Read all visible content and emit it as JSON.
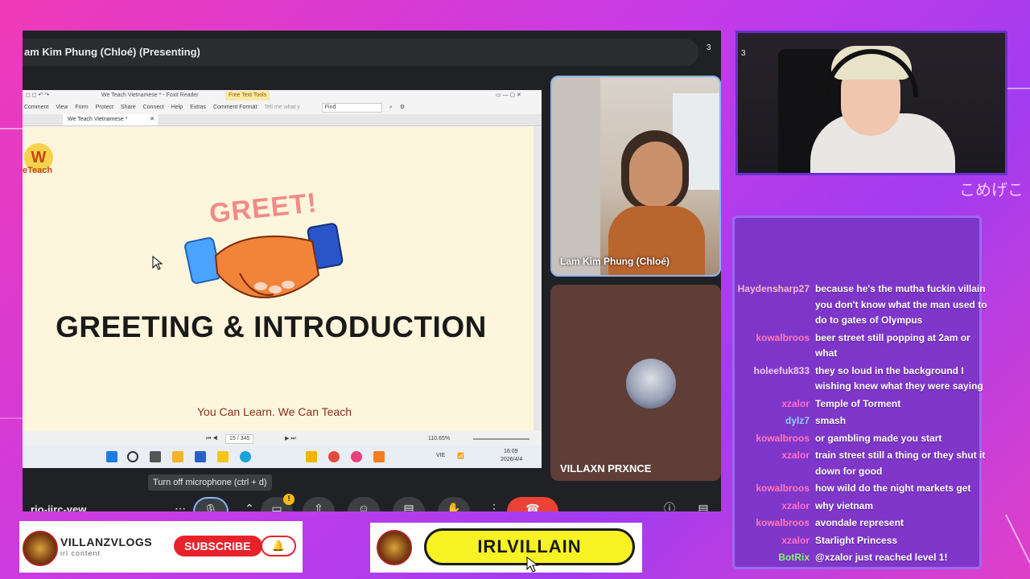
{
  "meet": {
    "presenting_label": "am Kim Phung (Chloé) (Presenting)",
    "participant_count": "3",
    "presenter_name": "Lam Kim Phung (Chloé)",
    "guest_name": "VILLAXN PRXNCE",
    "mic_tooltip": "Turn off microphone (ctrl + d)",
    "meeting_code": "rio-iirc-yew"
  },
  "foxit": {
    "window_title": "We Teach Vietnamese * - Foxit Reader",
    "free_text_tools": "Free Text Tools",
    "menu": [
      "Comment",
      "View",
      "Form",
      "Protect",
      "Share",
      "Connect",
      "Help",
      "Extras",
      "Comment Format",
      "Tell me what y"
    ],
    "find_placeholder": "Find",
    "doc_tab": "We Teach Vietnamese *",
    "page_indicator": "15 / 345",
    "zoom": "110.65%"
  },
  "slide": {
    "logo_letter": "W",
    "logo_text": "eTeach",
    "greet_word": "GREET!",
    "title": "GREETING & INTRODUCTION",
    "tagline": "You Can Learn. We Can Teach"
  },
  "taskbar": {
    "language": "VIE",
    "time": "16:09",
    "date": "2026/4/4"
  },
  "chat": {
    "messages": [
      {
        "user": "Haydensharp27",
        "color": "#f6b8c8",
        "text": "because he's the mutha fuckin villain you don't know what the man used to do to gates of Olympus"
      },
      {
        "user": "kowalbroos",
        "color": "#ff7ab8",
        "text": "beer street still popping at 2am or what"
      },
      {
        "user": "holeefuk833",
        "color": "#f2c8ff",
        "text": "they so loud in the background I wishing knew what they were saying"
      },
      {
        "user": "xzalor",
        "color": "#ff6fd0",
        "text": "Temple of Torment"
      },
      {
        "user": "dylz7",
        "color": "#8fd3ff",
        "text": "smash"
      },
      {
        "user": "kowalbroos",
        "color": "#ff7ab8",
        "text": "or gambling made you start"
      },
      {
        "user": "xzalor",
        "color": "#ff6fd0",
        "text": "train street still a thing or they shut it down for good"
      },
      {
        "user": "kowalbroos",
        "color": "#ff7ab8",
        "text": "how wild do the night markets get"
      },
      {
        "user": "xzalor",
        "color": "#ff6fd0",
        "text": "why vietnam"
      },
      {
        "user": "kowalbroos",
        "color": "#ff7ab8",
        "text": "avondale represent"
      },
      {
        "user": "xzalor",
        "color": "#ff6fd0",
        "text": "Starlight Princess"
      },
      {
        "user": "BotRix",
        "color": "#7dff6a",
        "text": "@xzalor just reached level 1!"
      }
    ]
  },
  "overlay": {
    "jp_text": "こめげこ",
    "brand_name": "VILLANZVLOGS",
    "brand_sub": "irl content",
    "subscribe_label": "SUBSCRIBE",
    "bell_icon": "bell-icon",
    "handle": "IRLVILLAIN"
  },
  "colors": {
    "meet_bg": "#202124",
    "chat_bg": "#7d36c9",
    "subscribe_red": "#e7222b",
    "handle_yellow": "#f7f224"
  }
}
